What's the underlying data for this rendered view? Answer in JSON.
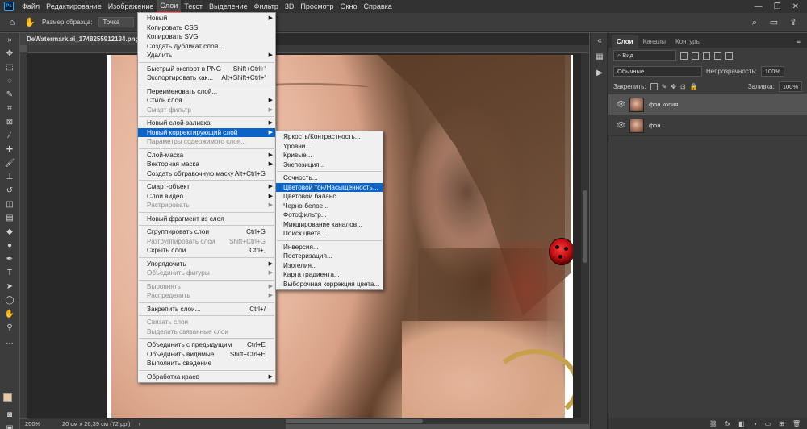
{
  "menubar": {
    "logo": "Ps",
    "items": [
      "Файл",
      "Редактирование",
      "Изображение",
      "Слои",
      "Текст",
      "Выделение",
      "Фильтр",
      "3D",
      "Просмотр",
      "Окно",
      "Справка"
    ],
    "active_index": 3,
    "window_controls": [
      "—",
      "❐",
      "✕"
    ]
  },
  "options_bar": {
    "sample_size_label": "Размер образца:",
    "sample_size_value": "Точка"
  },
  "document": {
    "tab_title": "DeWatermark.ai_1748255912134.png @",
    "status_zoom": "200%",
    "status_info": "20 см x 26,39 см (72 ppi)"
  },
  "layers_panel": {
    "tabs": [
      "Слои",
      "Каналы",
      "Контуры"
    ],
    "filter_label": "Вид",
    "blend_mode": "Обычные",
    "opacity_label": "Непрозрачность:",
    "opacity_value": "100%",
    "lock_label": "Закрепить:",
    "fill_label": "Заливка:",
    "fill_value": "100%",
    "layers": [
      {
        "name": "фон копия",
        "selected": true
      },
      {
        "name": "фон",
        "selected": false
      }
    ],
    "footer_icons": [
      "link-icon",
      "fx-icon",
      "mask-icon",
      "adjustment-icon",
      "group-icon",
      "new-layer-icon",
      "trash-icon"
    ]
  },
  "layers_menu": {
    "items": [
      {
        "label": "Новый",
        "shortcut": "",
        "submenu": true,
        "disabled": false,
        "sep_after": false
      },
      {
        "label": "Копировать CSS",
        "shortcut": "",
        "submenu": false,
        "disabled": false,
        "sep_after": false
      },
      {
        "label": "Копировать SVG",
        "shortcut": "",
        "submenu": false,
        "disabled": false,
        "sep_after": false
      },
      {
        "label": "Создать дубликат слоя...",
        "shortcut": "",
        "submenu": false,
        "disabled": false,
        "sep_after": false
      },
      {
        "label": "Удалить",
        "shortcut": "",
        "submenu": true,
        "disabled": false,
        "sep_after": true
      },
      {
        "label": "Быстрый экспорт в PNG",
        "shortcut": "Shift+Ctrl+'",
        "submenu": false,
        "disabled": false,
        "sep_after": false
      },
      {
        "label": "Экспортировать как...",
        "shortcut": "Alt+Shift+Ctrl+'",
        "submenu": false,
        "disabled": false,
        "sep_after": true
      },
      {
        "label": "Переименовать слой...",
        "shortcut": "",
        "submenu": false,
        "disabled": false,
        "sep_after": false
      },
      {
        "label": "Стиль слоя",
        "shortcut": "",
        "submenu": true,
        "disabled": false,
        "sep_after": false
      },
      {
        "label": "Смарт-фильтр",
        "shortcut": "",
        "submenu": true,
        "disabled": true,
        "sep_after": true
      },
      {
        "label": "Новый слой-заливка",
        "shortcut": "",
        "submenu": true,
        "disabled": false,
        "sep_after": false
      },
      {
        "label": "Новый корректирующий слой",
        "shortcut": "",
        "submenu": true,
        "disabled": false,
        "highlighted": true,
        "sep_after": false
      },
      {
        "label": "Параметры содержимого слоя...",
        "shortcut": "",
        "submenu": false,
        "disabled": true,
        "sep_after": true
      },
      {
        "label": "Слой-маска",
        "shortcut": "",
        "submenu": true,
        "disabled": false,
        "sep_after": false
      },
      {
        "label": "Векторная маска",
        "shortcut": "",
        "submenu": true,
        "disabled": false,
        "sep_after": false
      },
      {
        "label": "Создать обтравочную маску",
        "shortcut": "Alt+Ctrl+G",
        "submenu": false,
        "disabled": false,
        "sep_after": true
      },
      {
        "label": "Смарт-объект",
        "shortcut": "",
        "submenu": true,
        "disabled": false,
        "sep_after": false
      },
      {
        "label": "Слои видео",
        "shortcut": "",
        "submenu": true,
        "disabled": false,
        "sep_after": false
      },
      {
        "label": "Растрировать",
        "shortcut": "",
        "submenu": true,
        "disabled": true,
        "sep_after": true
      },
      {
        "label": "Новый фрагмент из слоя",
        "shortcut": "",
        "submenu": false,
        "disabled": false,
        "sep_after": true
      },
      {
        "label": "Сгруппировать слои",
        "shortcut": "Ctrl+G",
        "submenu": false,
        "disabled": false,
        "sep_after": false
      },
      {
        "label": "Разгруппировать слои",
        "shortcut": "Shift+Ctrl+G",
        "submenu": false,
        "disabled": true,
        "sep_after": false
      },
      {
        "label": "Скрыть слои",
        "shortcut": "Ctrl+,",
        "submenu": false,
        "disabled": false,
        "sep_after": true
      },
      {
        "label": "Упорядочить",
        "shortcut": "",
        "submenu": true,
        "disabled": false,
        "sep_after": false
      },
      {
        "label": "Объединить фигуры",
        "shortcut": "",
        "submenu": true,
        "disabled": true,
        "sep_after": true
      },
      {
        "label": "Выровнять",
        "shortcut": "",
        "submenu": true,
        "disabled": true,
        "sep_after": false
      },
      {
        "label": "Распределить",
        "shortcut": "",
        "submenu": true,
        "disabled": true,
        "sep_after": true
      },
      {
        "label": "Закрепить слои...",
        "shortcut": "Ctrl+/",
        "submenu": false,
        "disabled": false,
        "sep_after": true
      },
      {
        "label": "Связать слои",
        "shortcut": "",
        "submenu": false,
        "disabled": true,
        "sep_after": false
      },
      {
        "label": "Выделить связанные слои",
        "shortcut": "",
        "submenu": false,
        "disabled": true,
        "sep_after": true
      },
      {
        "label": "Объединить с предыдущим",
        "shortcut": "Ctrl+E",
        "submenu": false,
        "disabled": false,
        "sep_after": false
      },
      {
        "label": "Объединить видимые",
        "shortcut": "Shift+Ctrl+E",
        "submenu": false,
        "disabled": false,
        "sep_after": false
      },
      {
        "label": "Выполнить сведение",
        "shortcut": "",
        "submenu": false,
        "disabled": false,
        "sep_after": true
      },
      {
        "label": "Обработка краев",
        "shortcut": "",
        "submenu": true,
        "disabled": false,
        "sep_after": false
      }
    ]
  },
  "adjustment_submenu": {
    "items": [
      {
        "label": "Яркость/Контрастность...",
        "sep_after": false
      },
      {
        "label": "Уровни...",
        "sep_after": false
      },
      {
        "label": "Кривые...",
        "sep_after": false
      },
      {
        "label": "Экспозиция...",
        "sep_after": true
      },
      {
        "label": "Сочность...",
        "sep_after": false
      },
      {
        "label": "Цветовой тон/Насыщенность...",
        "highlighted": true,
        "sep_after": false
      },
      {
        "label": "Цветовой баланс...",
        "sep_after": false
      },
      {
        "label": "Черно-белое...",
        "sep_after": false
      },
      {
        "label": "Фотофильтр...",
        "sep_after": false
      },
      {
        "label": "Микширование каналов...",
        "sep_after": false
      },
      {
        "label": "Поиск цвета...",
        "sep_after": true
      },
      {
        "label": "Инверсия...",
        "sep_after": false
      },
      {
        "label": "Постеризация...",
        "sep_after": false
      },
      {
        "label": "Изогелия...",
        "sep_after": false
      },
      {
        "label": "Карта градиента...",
        "sep_after": false
      },
      {
        "label": "Выборочная коррекция цвета...",
        "sep_after": false
      }
    ]
  },
  "colors": {
    "highlight": "#0a64c8",
    "menu_bg": "#f0f0f0",
    "active_underline": "#e02020",
    "foreground_swatch": "#e9c9a5"
  }
}
